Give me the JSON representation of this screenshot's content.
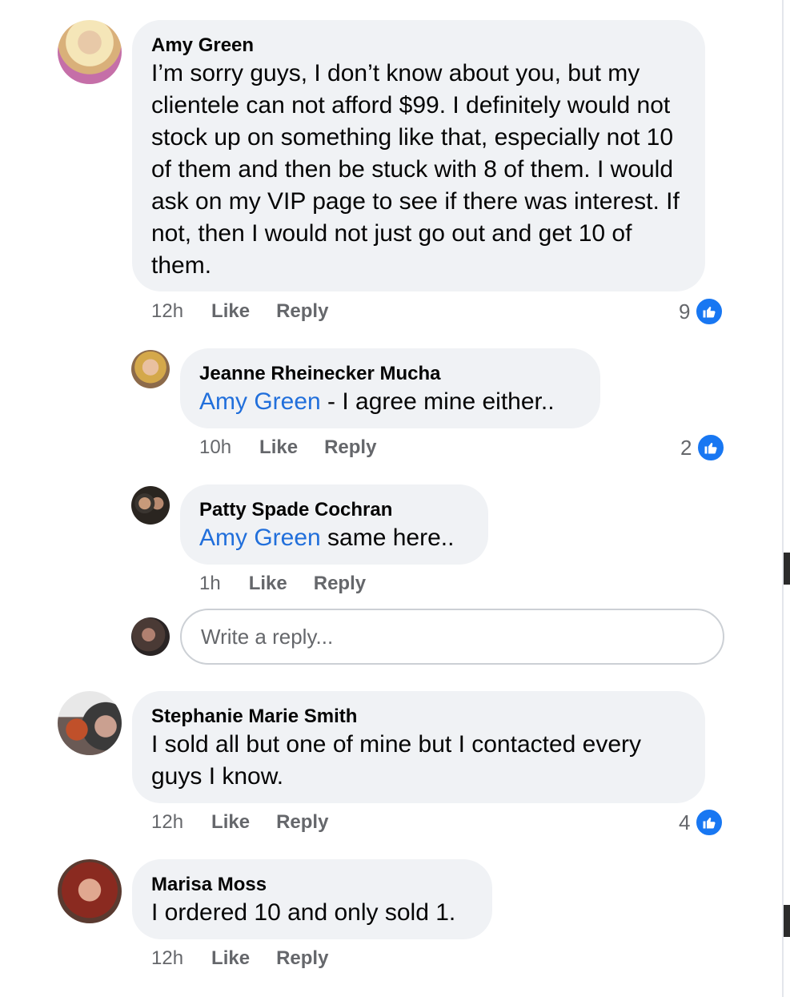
{
  "comments": [
    {
      "author": "Amy Green",
      "text": "I’m sorry guys, I don’t know about you, but my clientele can not afford $99. I definitely would not stock up on something like that, especially not 10 of them and then be stuck with 8 of them. I would ask on my VIP page to see if there was interest. If not, then I would not just go out and get 10 of them.",
      "time": "12h",
      "like_label": "Like",
      "reply_label": "Reply",
      "reactions": "9"
    },
    {
      "author": "Jeanne Rheinecker Mucha",
      "mention": "Amy Green",
      "text": " - I agree mine either..",
      "time": "10h",
      "like_label": "Like",
      "reply_label": "Reply",
      "reactions": "2"
    },
    {
      "author": "Patty Spade Cochran",
      "mention": "Amy Green",
      "text": " same here..",
      "time": "1h",
      "like_label": "Like",
      "reply_label": "Reply"
    },
    {
      "author": "Stephanie Marie Smith",
      "text": "I sold all but one of mine but I contacted every guys I know.",
      "time": "12h",
      "like_label": "Like",
      "reply_label": "Reply",
      "reactions": "4"
    },
    {
      "author": "Marisa Moss",
      "text": "I ordered 10 and only sold 1.",
      "time": "12h",
      "like_label": "Like",
      "reply_label": "Reply"
    }
  ],
  "reply_input": {
    "placeholder": "Write a reply..."
  },
  "colors": {
    "bubble": "#f0f2f5",
    "link": "#216fdb",
    "like_blue": "#1877f2",
    "meta": "#65676b"
  },
  "icons": {
    "reaction": "thumbs-up-icon"
  }
}
